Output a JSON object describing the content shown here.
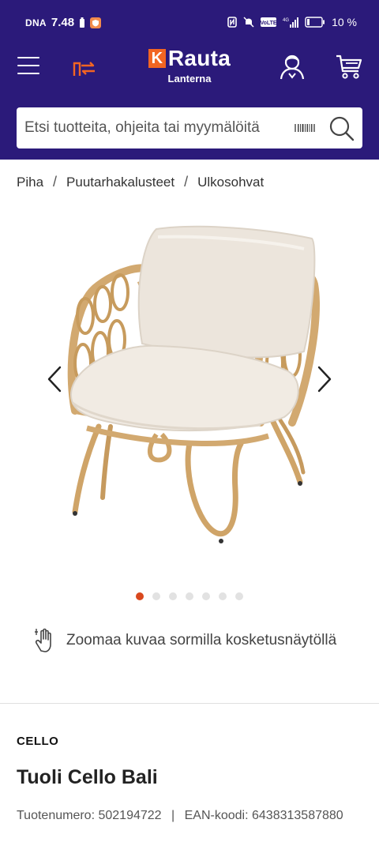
{
  "status_bar": {
    "carrier": "DNA",
    "time": "7.48",
    "battery_percent": "10 %"
  },
  "header": {
    "logo_letter": "K",
    "logo_text": "Rauta",
    "store_name": "Lanterna",
    "icons": [
      "menu-icon",
      "compare-icon",
      "user-icon",
      "cart-icon"
    ],
    "brand_color": "#2b1a7a",
    "accent_color": "#f26522"
  },
  "search": {
    "placeholder": "Etsi tuotteita, ohjeita tai myymälöitä",
    "value": ""
  },
  "breadcrumb": {
    "items": [
      "Piha",
      "Puutarhakalusteet",
      "Ulkosohvat"
    ]
  },
  "gallery": {
    "image_count": 7,
    "active_index": 0,
    "active_dot_color": "#d9481e"
  },
  "zoom_hint": {
    "text": "Zoomaa kuvaa sormilla kosketusnäytöllä"
  },
  "product": {
    "brand": "CELLO",
    "name": "Tuoli Cello Bali",
    "product_number_label": "Tuotenumero:",
    "product_number": "502194722",
    "ean_label": "EAN-koodi:",
    "ean": "6438313587880"
  }
}
